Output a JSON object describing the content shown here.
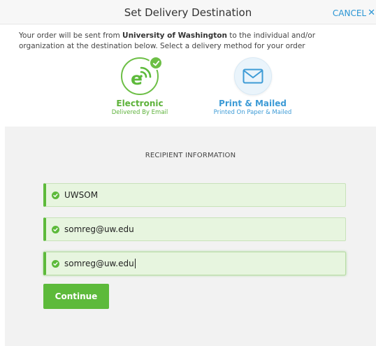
{
  "header": {
    "title": "Set Delivery Destination",
    "cancel_label": "CANCEL"
  },
  "intro": {
    "text_before": "Your order will be sent from ",
    "institution": "University of Washington",
    "text_after": " to the individual and/or organization at the destination below. Select a delivery method for your order"
  },
  "delivery_methods": [
    {
      "label": "Electronic",
      "sub": "Delivered By Email",
      "icon": "electronic-e-icon",
      "selected": true
    },
    {
      "label": "Print & Mailed",
      "sub": "Printed On Paper & Mailed",
      "icon": "envelope-icon",
      "selected": false
    }
  ],
  "recipient": {
    "section_title": "RECIPIENT INFORMATION",
    "fields": [
      {
        "value": "UWSOM"
      },
      {
        "value": "somreg@uw.edu"
      },
      {
        "value": "somreg@uw.edu"
      }
    ],
    "continue_label": "Continue"
  },
  "colors": {
    "green": "#5dba3b",
    "blue": "#3d9bd6",
    "field_bg": "#e7f5df"
  }
}
